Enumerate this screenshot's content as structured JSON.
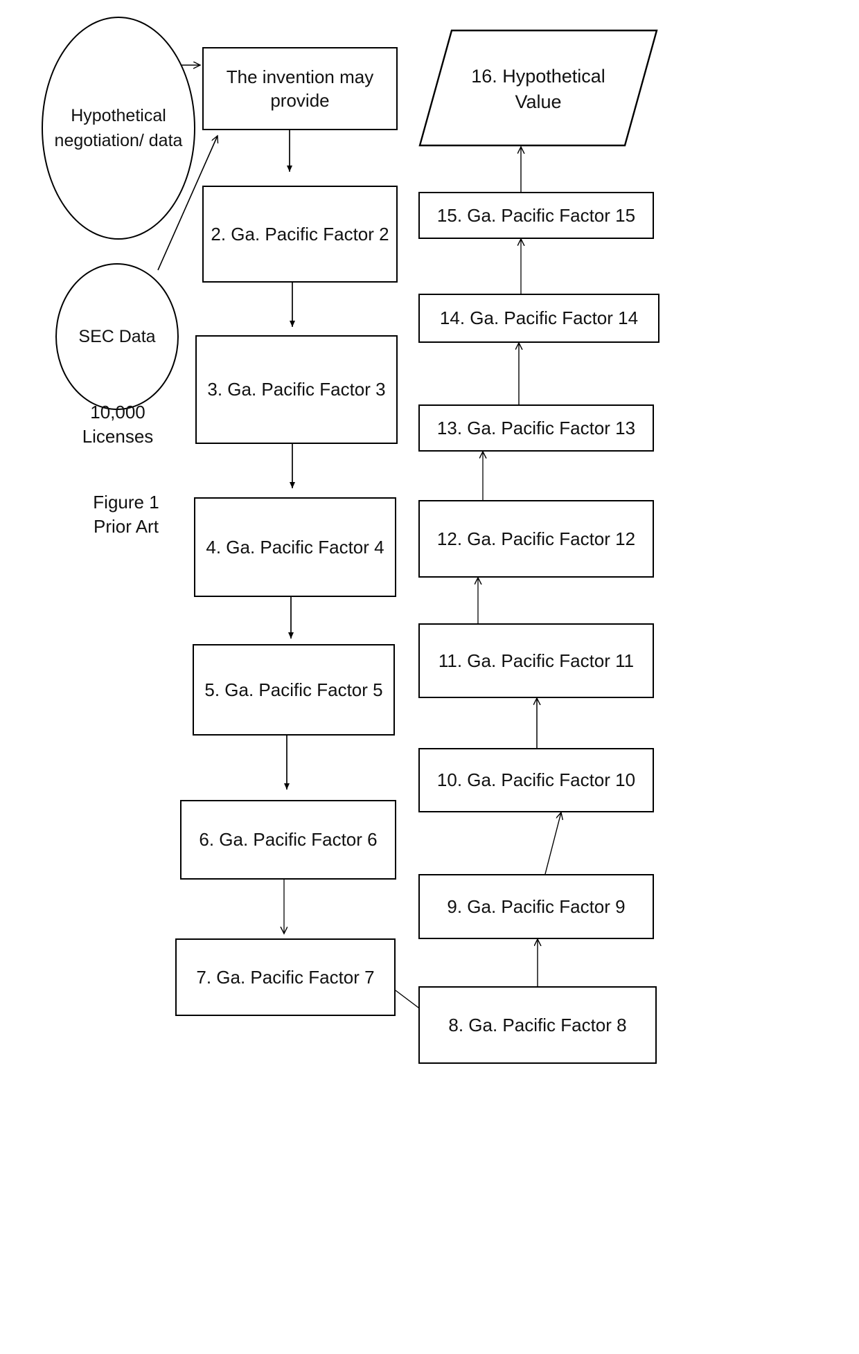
{
  "figure": {
    "caption_line1": "Figure  1",
    "caption_line2": "Prior Art",
    "caption": "Figure  1\nPrior Art"
  },
  "inputs": {
    "ellipse_hypothetical": "Hypothetical\nnegotiation/\ndata",
    "ellipse_sec": "SEC\nData",
    "licenses_label": "10,000\nLicenses"
  },
  "left_column": {
    "box_1": "The invention may\nprovide",
    "box_2": "2. Ga. Pacific Factor  2",
    "box_3": "3. Ga. Pacific Factor  3",
    "box_4": "4. Ga. Pacific Factor  4",
    "box_5": "5. Ga. Pacific Factor  5",
    "box_6": "6. Ga. Pacific Factor 6",
    "box_7": "7. Ga. Pacific Factor 7"
  },
  "right_column": {
    "box_8": "8. Ga. Pacific Factor 8",
    "box_9": "9. Ga. Pacific Factor 9",
    "box_10": "10. Ga. Pacific Factor 10",
    "box_11": "11. Ga. Pacific Factor 11",
    "box_12": "12. Ga. Pacific Factor 12",
    "box_13": "13. Ga. Pacific Factor 13",
    "box_14": "14. Ga. Pacific Factor 14",
    "box_15": "15. Ga. Pacific Factor 15",
    "box_16": "16. Hypothetical\nValue"
  },
  "chart_data": {
    "type": "diagram",
    "title": "Figure 1 Prior Art",
    "diagram_kind": "flowchart",
    "nodes": [
      {
        "id": "hypo-negotiation",
        "shape": "ellipse",
        "label": "Hypothetical negotiation/ data"
      },
      {
        "id": "sec-data",
        "shape": "ellipse",
        "label": "SEC Data"
      },
      {
        "id": "licenses",
        "shape": "text",
        "label": "10,000 Licenses"
      },
      {
        "id": "box1",
        "shape": "rectangle",
        "label": "The invention may provide"
      },
      {
        "id": "box2",
        "shape": "rectangle",
        "label": "2. Ga. Pacific Factor  2"
      },
      {
        "id": "box3",
        "shape": "rectangle",
        "label": "3. Ga. Pacific Factor  3"
      },
      {
        "id": "box4",
        "shape": "rectangle",
        "label": "4. Ga. Pacific Factor  4"
      },
      {
        "id": "box5",
        "shape": "rectangle",
        "label": "5. Ga. Pacific Factor  5"
      },
      {
        "id": "box6",
        "shape": "rectangle",
        "label": "6. Ga. Pacific Factor 6"
      },
      {
        "id": "box7",
        "shape": "rectangle",
        "label": "7. Ga. Pacific Factor 7"
      },
      {
        "id": "box8",
        "shape": "rectangle",
        "label": "8. Ga. Pacific Factor 8"
      },
      {
        "id": "box9",
        "shape": "rectangle",
        "label": "9. Ga. Pacific Factor 9"
      },
      {
        "id": "box10",
        "shape": "rectangle",
        "label": "10. Ga. Pacific Factor 10"
      },
      {
        "id": "box11",
        "shape": "rectangle",
        "label": "11. Ga. Pacific Factor 11"
      },
      {
        "id": "box12",
        "shape": "rectangle",
        "label": "12. Ga. Pacific Factor 12"
      },
      {
        "id": "box13",
        "shape": "rectangle",
        "label": "13. Ga. Pacific Factor 13"
      },
      {
        "id": "box14",
        "shape": "rectangle",
        "label": "14. Ga. Pacific Factor 14"
      },
      {
        "id": "box15",
        "shape": "rectangle",
        "label": "15. Ga. Pacific Factor 15"
      },
      {
        "id": "box16",
        "shape": "parallelogram",
        "label": "16. Hypothetical Value"
      }
    ],
    "edges": [
      {
        "from": "hypo-negotiation",
        "to": "box1"
      },
      {
        "from": "sec-data",
        "to": "box1"
      },
      {
        "from": "box1",
        "to": "box2"
      },
      {
        "from": "box2",
        "to": "box3"
      },
      {
        "from": "box3",
        "to": "box4"
      },
      {
        "from": "box4",
        "to": "box5"
      },
      {
        "from": "box5",
        "to": "box6"
      },
      {
        "from": "box6",
        "to": "box7"
      },
      {
        "from": "box7",
        "to": "box8"
      },
      {
        "from": "box8",
        "to": "box9"
      },
      {
        "from": "box9",
        "to": "box10"
      },
      {
        "from": "box10",
        "to": "box11"
      },
      {
        "from": "box11",
        "to": "box12"
      },
      {
        "from": "box12",
        "to": "box13"
      },
      {
        "from": "box13",
        "to": "box14"
      },
      {
        "from": "box14",
        "to": "box15"
      },
      {
        "from": "box15",
        "to": "box16"
      }
    ]
  }
}
